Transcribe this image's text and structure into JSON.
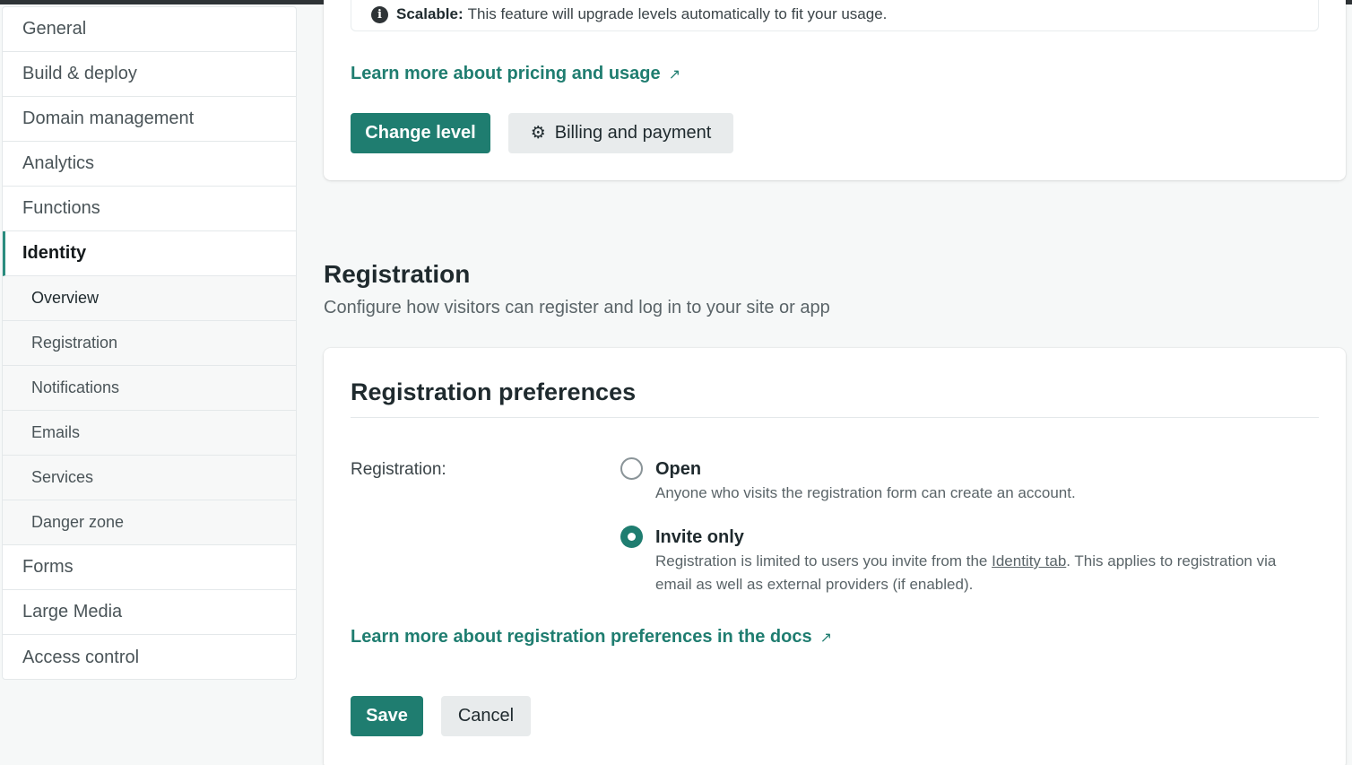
{
  "sidebar": {
    "items": [
      {
        "label": "General"
      },
      {
        "label": "Build & deploy"
      },
      {
        "label": "Domain management"
      },
      {
        "label": "Analytics"
      },
      {
        "label": "Functions"
      },
      {
        "label": "Identity"
      },
      {
        "label": "Forms"
      },
      {
        "label": "Large Media"
      },
      {
        "label": "Access control"
      }
    ],
    "active": "Identity",
    "identity_subitems": [
      {
        "label": "Overview"
      },
      {
        "label": "Registration"
      },
      {
        "label": "Notifications"
      },
      {
        "label": "Emails"
      },
      {
        "label": "Services"
      },
      {
        "label": "Danger zone"
      }
    ]
  },
  "pricing_card": {
    "notice_icon": "info-icon",
    "notice_bold": "Scalable:",
    "notice_text": "This feature will upgrade levels automatically to fit your usage.",
    "learn_more": "Learn more about pricing and usage",
    "change_level_label": "Change level",
    "billing_label": "Billing and payment",
    "billing_icon": "gear-icon"
  },
  "registration_section": {
    "title": "Registration",
    "subtitle": "Configure how visitors can register and log in to your site or app"
  },
  "registration_card": {
    "title": "Registration preferences",
    "field_label": "Registration:",
    "options": [
      {
        "label": "Open",
        "description": "Anyone who visits the registration form can create an account.",
        "selected": false
      },
      {
        "label": "Invite only",
        "description_before": "Registration is limited to users you invite from the ",
        "description_link": "Identity tab",
        "description_after": ". This applies to registration via email as well as external providers (if enabled).",
        "selected": true
      }
    ],
    "learn_more": "Learn more about registration preferences in the docs",
    "save_label": "Save",
    "cancel_label": "Cancel"
  },
  "colors": {
    "accent": "#1f7d70",
    "background": "#f6f8f8"
  }
}
